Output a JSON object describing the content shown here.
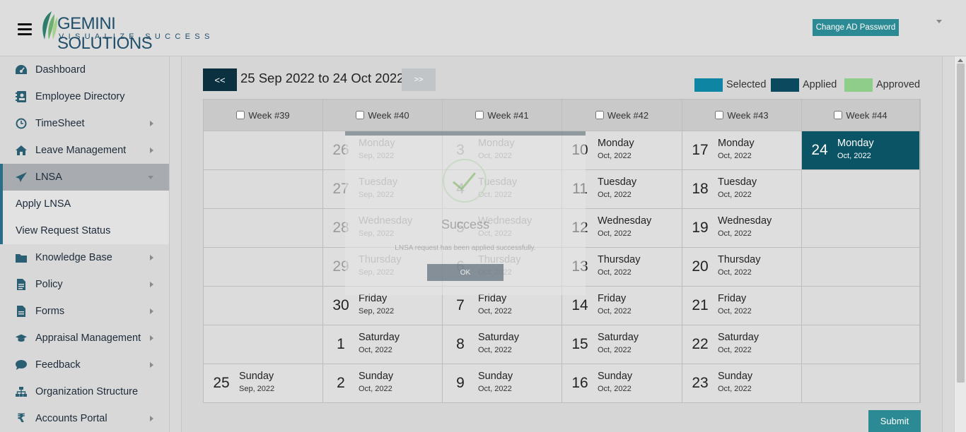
{
  "header": {
    "logo_main": "GEMINI SOLUTIONS",
    "logo_tagline": "VISUALIZE SUCCESS",
    "change_password_label": "Change AD Password"
  },
  "sidebar": {
    "items": [
      {
        "label": "Dashboard",
        "icon": "dashboard-icon"
      },
      {
        "label": "Employee Directory",
        "icon": "directory-icon"
      },
      {
        "label": "TimeSheet",
        "icon": "clock-icon"
      },
      {
        "label": "Leave Management",
        "icon": "home-icon"
      },
      {
        "label": "LNSA",
        "icon": "paper-plane-icon"
      },
      {
        "label": "Apply LNSA"
      },
      {
        "label": "View Request Status"
      },
      {
        "label": "Knowledge Base",
        "icon": "folder-icon"
      },
      {
        "label": "Policy",
        "icon": "document-icon"
      },
      {
        "label": "Forms",
        "icon": "form-icon"
      },
      {
        "label": "Appraisal Management",
        "icon": "graduation-cap-icon"
      },
      {
        "label": "Feedback",
        "icon": "chat-icon"
      },
      {
        "label": "Organization Structure",
        "icon": "sitemap-icon"
      },
      {
        "label": "Accounts Portal",
        "icon": "rupee-icon"
      }
    ]
  },
  "nav": {
    "prev_label": "<<",
    "next_label": ">>",
    "range": "25 Sep 2022 to 24 Oct 2022"
  },
  "legend": {
    "selected": {
      "label": "Selected",
      "color": "#0e86a3"
    },
    "applied": {
      "label": "Applied",
      "color": "#0b4a5e"
    },
    "approved": {
      "label": "Approved",
      "color": "#8fce8a"
    }
  },
  "calendar": {
    "weeks": [
      "Week #39",
      "Week #40",
      "Week #41",
      "Week #42",
      "Week #43",
      "Week #44"
    ],
    "columns": [
      [
        null,
        null,
        null,
        null,
        null,
        null,
        {
          "num": "25",
          "day": "Sunday",
          "mon": "Sep, 2022"
        }
      ],
      [
        {
          "num": "26",
          "day": "Monday",
          "mon": "Sep, 2022",
          "faded": true
        },
        {
          "num": "27",
          "day": "Tuesday",
          "mon": "Sep, 2022",
          "faded": true
        },
        {
          "num": "28",
          "day": "Wednesday",
          "mon": "Sep, 2022",
          "faded": true
        },
        {
          "num": "29",
          "day": "Thursday",
          "mon": "Sep, 2022",
          "faded": true
        },
        {
          "num": "30",
          "day": "Friday",
          "mon": "Sep, 2022"
        },
        {
          "num": "1",
          "day": "Saturday",
          "mon": "Oct, 2022"
        },
        {
          "num": "2",
          "day": "Sunday",
          "mon": "Oct, 2022"
        }
      ],
      [
        {
          "num": "3",
          "day": "Monday",
          "mon": "Oct, 2022",
          "faded": true
        },
        {
          "num": "4",
          "day": "Tuesday",
          "mon": "Oct, 2022",
          "faded": true
        },
        {
          "num": "5",
          "day": "Wednesday",
          "mon": "Oct, 2022",
          "faded": true
        },
        {
          "num": "6",
          "day": "Thursday",
          "mon": "Oct, 2022",
          "faded": true
        },
        {
          "num": "7",
          "day": "Friday",
          "mon": "Oct, 2022"
        },
        {
          "num": "8",
          "day": "Saturday",
          "mon": "Oct, 2022"
        },
        {
          "num": "9",
          "day": "Sunday",
          "mon": "Oct, 2022"
        }
      ],
      [
        {
          "num": "10",
          "day": "Monday",
          "mon": "Oct, 2022"
        },
        {
          "num": "11",
          "day": "Tuesday",
          "mon": "Oct, 2022"
        },
        {
          "num": "12",
          "day": "Wednesday",
          "mon": "Oct, 2022"
        },
        {
          "num": "13",
          "day": "Thursday",
          "mon": "Oct, 2022"
        },
        {
          "num": "14",
          "day": "Friday",
          "mon": "Oct, 2022"
        },
        {
          "num": "15",
          "day": "Saturday",
          "mon": "Oct, 2022"
        },
        {
          "num": "16",
          "day": "Sunday",
          "mon": "Oct, 2022"
        }
      ],
      [
        {
          "num": "17",
          "day": "Monday",
          "mon": "Oct, 2022"
        },
        {
          "num": "18",
          "day": "Tuesday",
          "mon": "Oct, 2022"
        },
        {
          "num": "19",
          "day": "Wednesday",
          "mon": "Oct, 2022"
        },
        {
          "num": "20",
          "day": "Thursday",
          "mon": "Oct, 2022"
        },
        {
          "num": "21",
          "day": "Friday",
          "mon": "Oct, 2022"
        },
        {
          "num": "22",
          "day": "Saturday",
          "mon": "Oct, 2022"
        },
        {
          "num": "23",
          "day": "Sunday",
          "mon": "Oct, 2022"
        }
      ],
      [
        {
          "num": "24",
          "day": "Monday",
          "mon": "Oct, 2022",
          "selected": true
        },
        null,
        null,
        null,
        null,
        null,
        null
      ]
    ]
  },
  "modal": {
    "title": "Success",
    "message": "LNSA request has been applied successfully.",
    "ok_label": "OK"
  },
  "submit_label": "Submit"
}
